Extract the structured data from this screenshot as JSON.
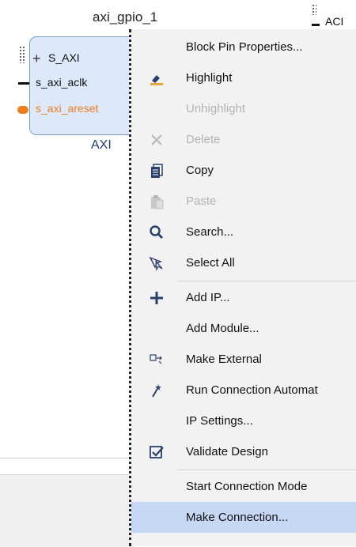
{
  "canvas": {
    "block_name": "axi_gpio_1",
    "block_subtitle": "AXI",
    "pins": [
      "S_AXI",
      "s_axi_aclk",
      "s_axi_areset"
    ],
    "right_label": "ACI"
  },
  "menu": {
    "items": [
      {
        "label": "Block Pin Properties...",
        "icon": "none",
        "disabled": false
      },
      {
        "label": "Highlight",
        "icon": "highlight-icon",
        "disabled": false
      },
      {
        "label": "Unhighlight",
        "icon": "none",
        "disabled": true
      },
      {
        "label": "Delete",
        "icon": "delete-icon",
        "disabled": true
      },
      {
        "label": "Copy",
        "icon": "copy-icon",
        "disabled": false
      },
      {
        "label": "Paste",
        "icon": "paste-icon",
        "disabled": true
      },
      {
        "label": "Search...",
        "icon": "search-icon",
        "disabled": false
      },
      {
        "label": "Select All",
        "icon": "select-all-icon",
        "disabled": false
      },
      {
        "label": "Add IP...",
        "icon": "add-icon",
        "disabled": false
      },
      {
        "label": "Add Module...",
        "icon": "none",
        "disabled": false
      },
      {
        "label": "Make External",
        "icon": "make-external-icon",
        "disabled": false
      },
      {
        "label": "Run Connection Automat",
        "icon": "wand-icon",
        "disabled": false
      },
      {
        "label": "IP Settings...",
        "icon": "none",
        "disabled": false
      },
      {
        "label": "Validate Design",
        "icon": "validate-icon",
        "disabled": false
      },
      {
        "label": "Start Connection Mode",
        "icon": "none",
        "disabled": false
      },
      {
        "label": "Make Connection...",
        "icon": "none",
        "disabled": false
      }
    ],
    "highlighted_item": "Make Connection..."
  },
  "colors": {
    "accent_highlight": "#c7d8f5",
    "reset_pin": "#ef7d1d",
    "block_fill": "#dde9fb"
  }
}
